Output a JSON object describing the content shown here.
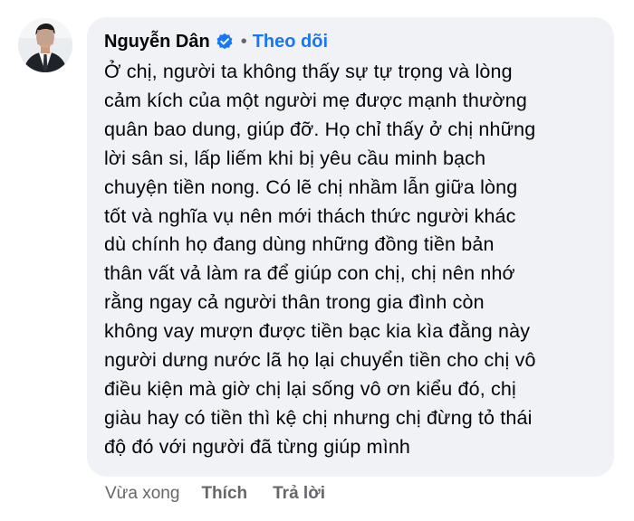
{
  "comment": {
    "author_name": "Nguyễn Dân",
    "verified_icon": "verified-badge-icon",
    "separator": "•",
    "follow_label": "Theo dõi",
    "text": "Ở chị, người ta không thấy sự tự trọng và lòng\ncảm kích của một người mẹ được mạnh thường\nquân bao dung, giúp đỡ. Họ chỉ thấy ở chị những\nlời sân si, lấp liếm khi bị yêu cầu minh bạch\nchuyện tiền nong. Có lẽ chị nhầm lẫn giữa lòng\ntốt và nghĩa vụ nên mới thách thức người khác\ndù chính họ đang dùng những đồng tiền bản\nthân vất vả làm ra để giúp con chị, chị nên nhớ\nrằng ngay cả người thân trong gia đình còn\nkhông vay mượn được tiền bạc kia kìa đằng này\nngười dưng nước lã họ lại chuyển tiền cho chị vô\nđiều kiện mà giờ chị lại sống vô ơn kiểu đó, chị\ngiàu hay có tiền thì kệ chị nhưng chị đừng tỏ thái\nđộ đó với người đã từng giúp mình"
  },
  "actions": {
    "timestamp": "Vừa xong",
    "like_label": "Thích",
    "reply_label": "Trả lời"
  },
  "colors": {
    "bubble_background": "#f0f2f5",
    "link_blue": "#1877f2",
    "secondary_text": "#65676b",
    "primary_text": "#050505"
  }
}
